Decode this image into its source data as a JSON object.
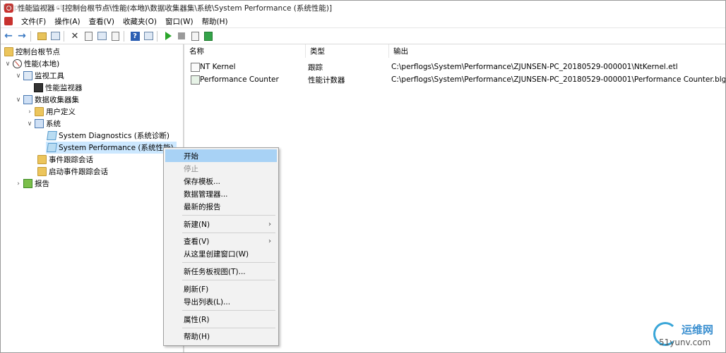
{
  "window": {
    "title": "性能监视器 - [控制台根节点\\性能(本地)\\数据收集器集\\系统\\System Performance (系统性能)]",
    "watermark": "http://blog.51cto.com/xxxx/index.php"
  },
  "menubar": [
    "文件(F)",
    "操作(A)",
    "查看(V)",
    "收藏夹(O)",
    "窗口(W)",
    "帮助(H)"
  ],
  "tree": {
    "root": "控制台根节点",
    "items": [
      {
        "label": "性能(本地)"
      },
      {
        "label": "监视工具"
      },
      {
        "label": "性能监视器"
      },
      {
        "label": "数据收集器集"
      },
      {
        "label": "用户定义"
      },
      {
        "label": "系统"
      },
      {
        "label": "System Diagnostics (系统诊断)"
      },
      {
        "label": "System Performance (系统性能)"
      },
      {
        "label": "事件跟踪会话"
      },
      {
        "label": "启动事件跟踪会话"
      },
      {
        "label": "报告"
      }
    ]
  },
  "list": {
    "columns": [
      "名称",
      "类型",
      "输出"
    ],
    "rows": [
      {
        "name": "NT Kernel",
        "type": "跟踪",
        "output": "C:\\perflogs\\System\\Performance\\ZJUNSEN-PC_20180529-000001\\NtKernel.etl"
      },
      {
        "name": "Performance Counter",
        "type": "性能计数器",
        "output": "C:\\perflogs\\System\\Performance\\ZJUNSEN-PC_20180529-000001\\Performance Counter.blg"
      }
    ]
  },
  "context_menu": {
    "items": [
      "开始",
      "停止",
      "保存模板...",
      "数据管理器...",
      "最新的报告",
      "新建(N)",
      "查看(V)",
      "从这里创建窗口(W)",
      "新任务板视图(T)...",
      "刷新(F)",
      "导出列表(L)...",
      "属性(R)",
      "帮助(H)"
    ]
  },
  "logo": {
    "name": "运维网",
    "domain": "51yunv.com"
  }
}
